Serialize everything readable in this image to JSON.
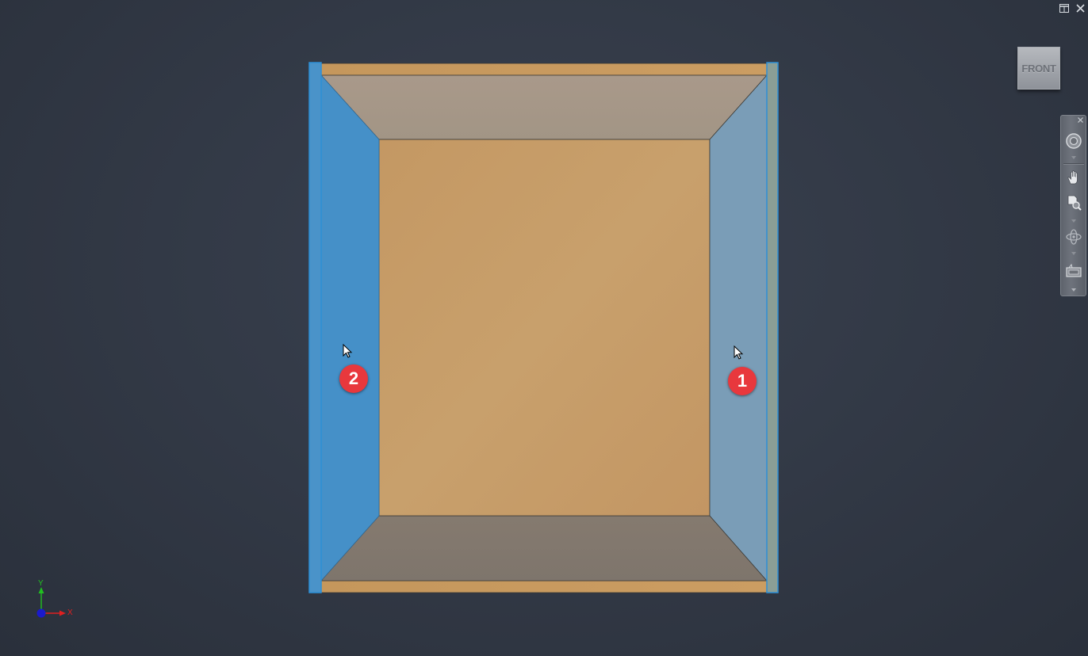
{
  "window_controls": {
    "restore_icon": "window-tile-icon",
    "close_icon": "close-icon"
  },
  "viewcube": {
    "face_label": "FRONT"
  },
  "navigation_bar": {
    "tools": [
      "full-navigation-wheel-icon",
      "pan-icon",
      "zoom-window-icon",
      "orbit-icon",
      "look-at-icon"
    ]
  },
  "markers": {
    "right_panel_marker": "1",
    "left_panel_marker": "2"
  },
  "axis_triad": {
    "x_label": "X",
    "y_label": "Y"
  },
  "colors": {
    "background": "#333a47",
    "wood": "#c69a63",
    "selected_panel": "#4590c8",
    "marker": "#e8383d",
    "x_axis": "#e02020",
    "y_axis": "#21c021",
    "z_axis": "#1a1acc"
  }
}
